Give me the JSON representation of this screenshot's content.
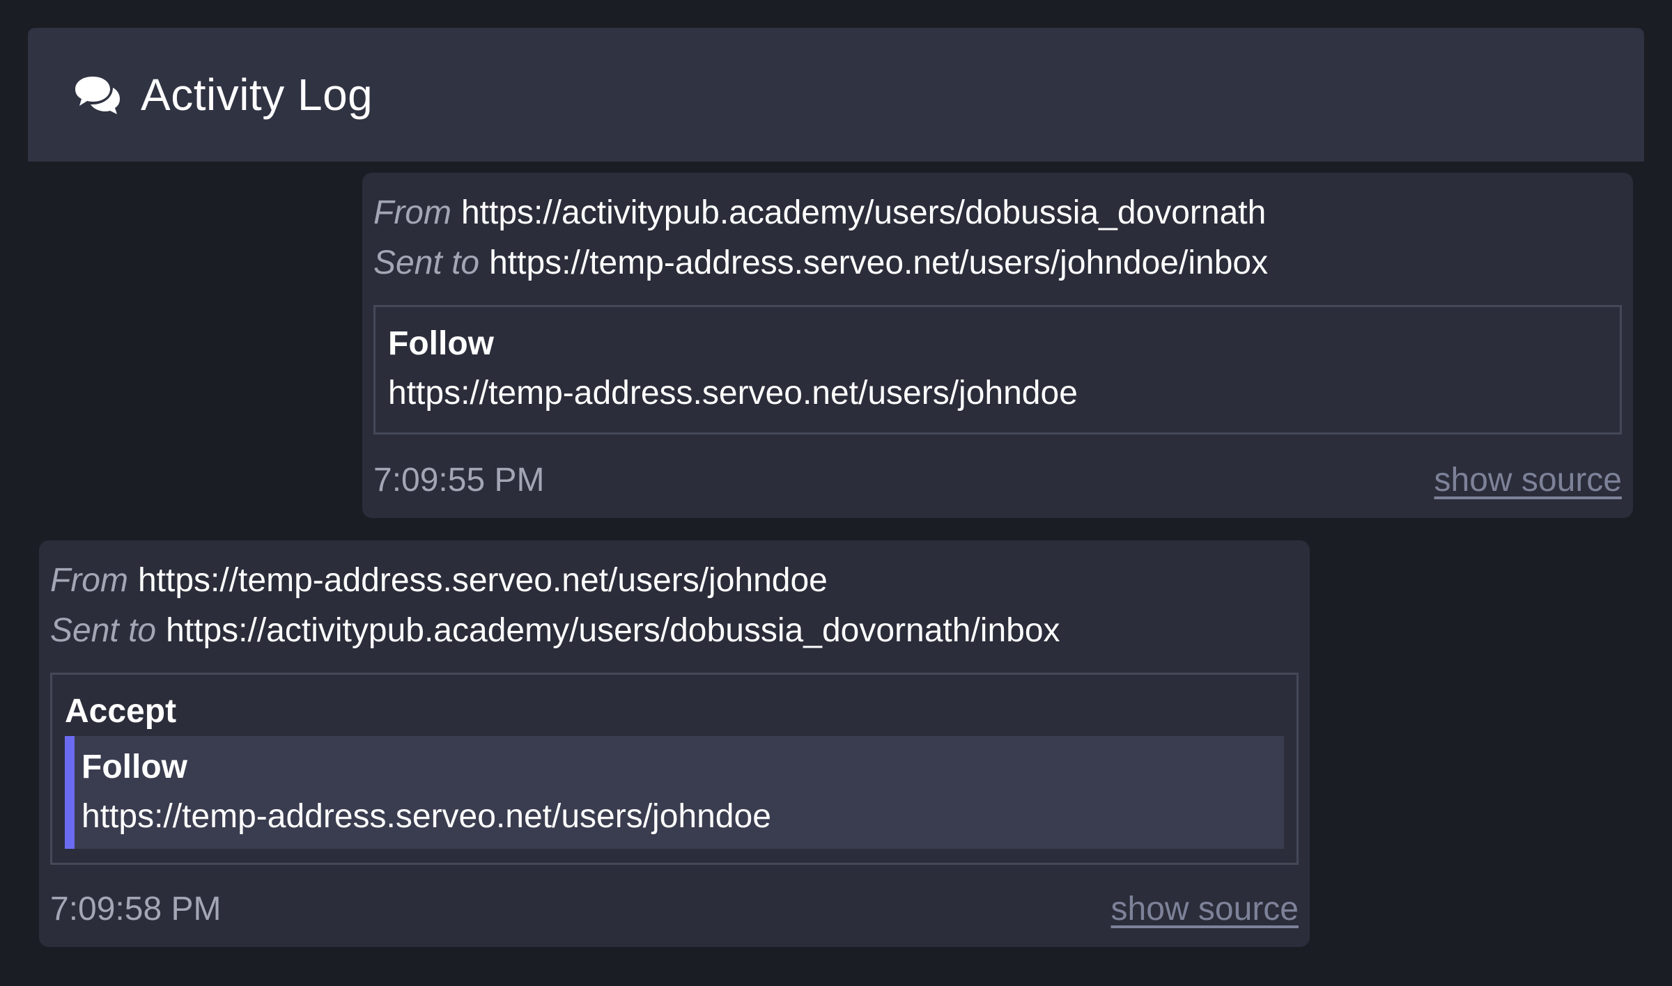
{
  "header": {
    "title": "Activity Log",
    "icon": "chat-bubbles-icon"
  },
  "messages": [
    {
      "direction": "outgoing",
      "from_label": "From",
      "from": "https://activitypub.academy/users/dobussia_dovornath",
      "to_label": "Sent to",
      "to": "https://temp-address.serveo.net/users/johndoe/inbox",
      "activity": {
        "type": "Follow",
        "object": "https://temp-address.serveo.net/users/johndoe"
      },
      "time": "7:09:55 PM",
      "show_source": "show source"
    },
    {
      "direction": "incoming",
      "from_label": "From",
      "from": "https://temp-address.serveo.net/users/johndoe",
      "to_label": "Sent to",
      "to": "https://activitypub.academy/users/dobussia_dovornath/inbox",
      "activity": {
        "type": "Accept",
        "object": {
          "type": "Follow",
          "object": "https://temp-address.serveo.net/users/johndoe"
        }
      },
      "time": "7:09:58 PM",
      "show_source": "show source"
    }
  ],
  "colors": {
    "background": "#1b1d24",
    "header": "#303342",
    "message": "#2b2d3a",
    "nested": "#3a3d4f",
    "accent": "#6b6bf2",
    "muted_text": "#a3a6b4",
    "link": "#7e8299"
  }
}
